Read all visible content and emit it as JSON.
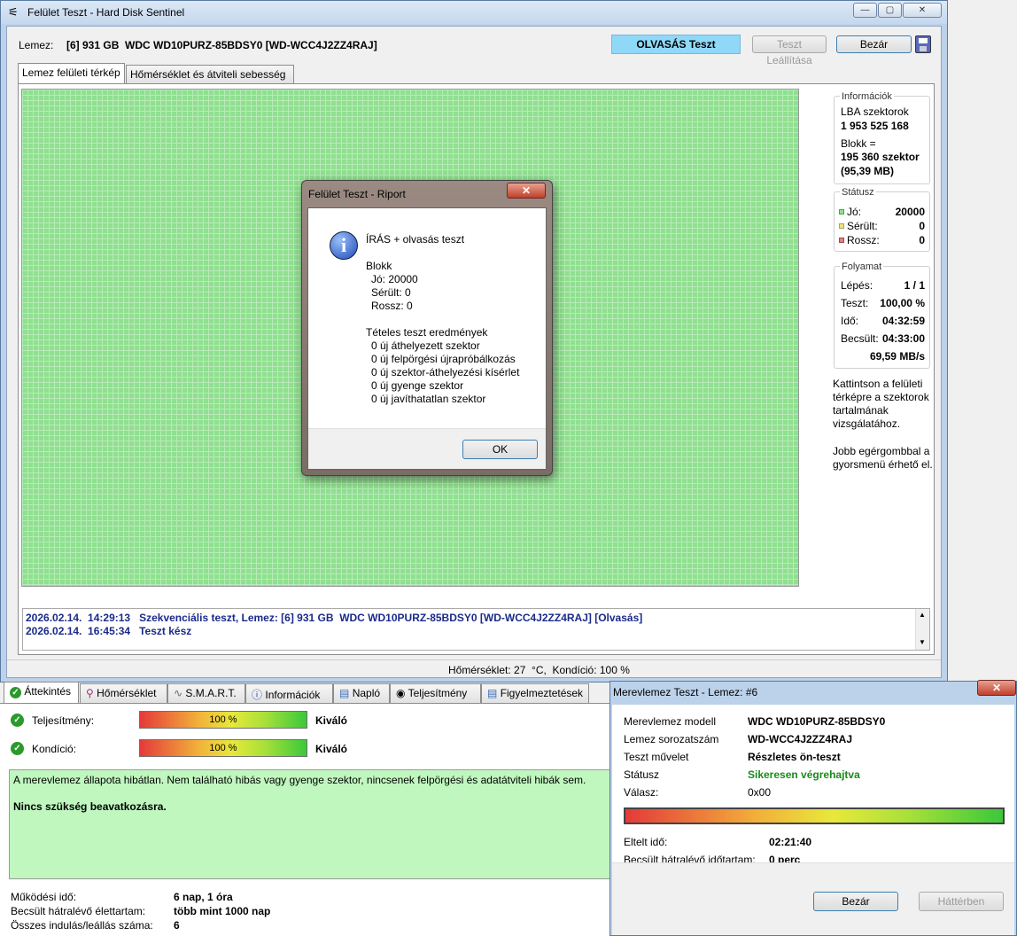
{
  "main_window": {
    "title": "Felület Teszt - Hard Disk Sentinel",
    "disk_label": "Lemez:",
    "disk_value": "[6] 931 GB  WDC WD10PURZ-85BDSY0 [WD-WCC4J2ZZ4RAJ]",
    "test_status": "OLVASÁS Teszt",
    "stop_button": "Teszt Leállítása",
    "close_button": "Bezár",
    "tabs": [
      "Lemez felületi térkép",
      "Hőmérséklet és átviteli sebesség"
    ],
    "info": {
      "title": "Információk",
      "lba_label": "LBA szektorok",
      "lba_value": "1 953 525 168",
      "block_label": "Blokk =",
      "block_value": "195 360 szektor",
      "block_size": "(95,39 MB)"
    },
    "status": {
      "title": "Státusz",
      "good_label": "Jó:",
      "good_value": "20000",
      "damaged_label": "Sérült:",
      "damaged_value": "0",
      "bad_label": "Rossz:",
      "bad_value": "0"
    },
    "progress": {
      "title": "Folyamat",
      "step_label": "Lépés:",
      "step_value": "1 / 1",
      "test_label": "Teszt:",
      "test_value": "100,00 %",
      "time_label": "Idő:",
      "time_value": "04:32:59",
      "est_label": "Becsült:",
      "est_value": "04:33:00",
      "speed": "69,59 MB/s"
    },
    "hint1": "Kattintson a felületi térképre a szektorok tartalmának vizsgálatához.",
    "hint2": "Jobb egérgombbal a gyorsmenü érhető el.",
    "log": [
      "2026.02.14.  14:29:13   Szekvenciális teszt, Lemez: [6] 931 GB  WDC WD10PURZ-85BDSY0 [WD-WCC4J2ZZ4RAJ] [Olvasás]",
      "2026.02.14.  16:45:34   Teszt kész"
    ],
    "statusbar": "Hőmérséklet: 27  °C,  Kondíció: 100 %"
  },
  "dialog": {
    "title": "Felület Teszt - Riport",
    "heading": "ÍRÁS + olvasás teszt",
    "block_title": "Blokk",
    "block_lines": [
      "Jó: 20000",
      "Sérült: 0",
      "Rossz: 0"
    ],
    "results_title": "Tételes teszt eredmények",
    "results": [
      "0 új áthelyezett szektor",
      "0 új felpörgési újrapróbálkozás",
      "0 új szektor-áthelyezési kísérlet",
      "0 új gyenge szektor",
      "0 új javíthatatlan szektor"
    ],
    "ok_button": "OK",
    "close_glyph": "✕"
  },
  "bottom": {
    "tabs": [
      "Áttekintés",
      "Hőmérséklet",
      "S.M.A.R.T.",
      "Információk",
      "Napló",
      "Teljesítmény",
      "Figyelmeztetések"
    ],
    "performance_label": "Teljesítmény:",
    "performance_bar": "100 %",
    "performance_value": "Kiváló",
    "condition_label": "Kondíció:",
    "condition_bar": "100 %",
    "condition_value": "Kiváló",
    "performance_fraction": 1.0,
    "condition_fraction": 1.0,
    "message": "A merevlemez állapota hibátlan. Nem található hibás vagy gyenge szektor, nincsenek felpörgési és adatátviteli hibák sem.",
    "message_bold": "Nincs szükség beavatkozásra.",
    "uptime_label": "Működési idő:",
    "uptime_value": "6 nap, 1 óra",
    "life_label": "Becsült hátralévő élettartam:",
    "life_value": "több mint 1000 nap",
    "starts_label": "Összes indulás/leállás száma:",
    "starts_value": "6",
    "message_bg": "#bff7bf"
  },
  "disk_test": {
    "title": "Merevlemez Teszt - Lemez: #6",
    "model_label": "Merevlemez modell",
    "model_value": "WDC WD10PURZ-85BDSY0",
    "serial_label": "Lemez sorozatszám",
    "serial_value": "WD-WCC4J2ZZ4RAJ",
    "op_label": "Teszt művelet",
    "op_value": "Részletes ön-teszt",
    "status_label": "Státusz",
    "status_value": "Sikeresen végrehajtva",
    "answer_label": "Válasz:",
    "answer_value": "0x00",
    "elapsed_label": "Eltelt idő:",
    "elapsed_value": "02:21:40",
    "remaining_label": "Becsült hátralévő időtartam:",
    "remaining_value": "0 perc",
    "progress_fraction": 1.0,
    "close_button": "Bezár",
    "background_button": "Háttérben",
    "close_glyph": "✕"
  }
}
